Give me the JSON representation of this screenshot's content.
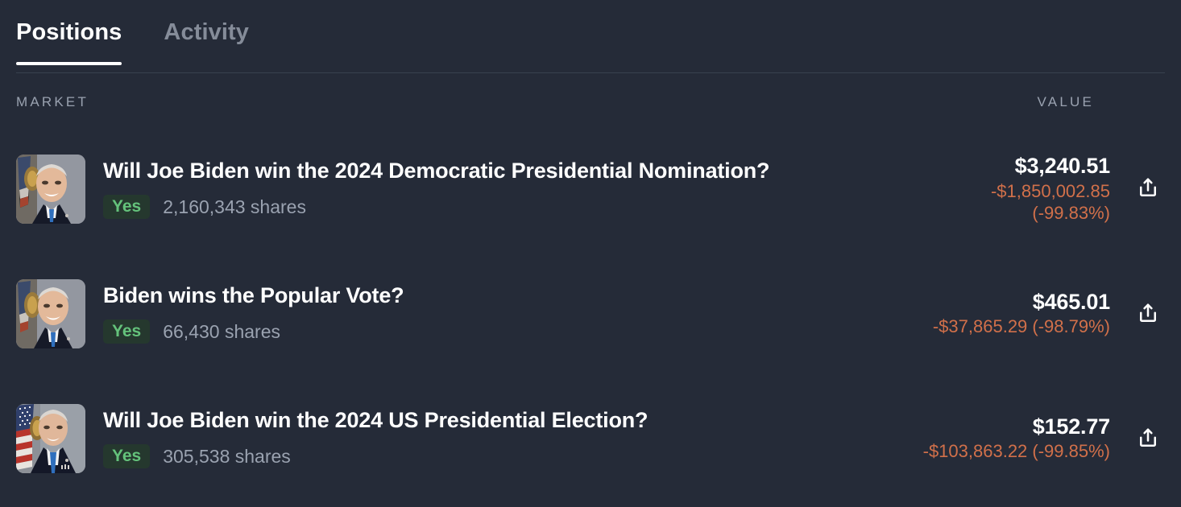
{
  "tabs": [
    {
      "label": "Positions",
      "active": true
    },
    {
      "label": "Activity",
      "active": false
    }
  ],
  "columns": {
    "market": "MARKET",
    "value": "VALUE"
  },
  "colors": {
    "background": "#252b38",
    "text_primary": "#ffffff",
    "text_muted": "#9aa2b0",
    "loss": "#d1704a",
    "yes_text": "#64c27b",
    "yes_background": "#25382e",
    "active_tab_underline": "#ffffff"
  },
  "positions": [
    {
      "avatar": "joe-biden-portrait",
      "title": "Will Joe Biden win the 2024 Democratic Presidential Nomination?",
      "outcome": "Yes",
      "shares": "2,160,343 shares",
      "value": "$3,240.51",
      "change": "-$1,850,002.85 (-99.83%)",
      "change_line1": "-$1,850,002.85",
      "change_line2": "(-99.83%)",
      "change_wraps": true,
      "share_action": "share"
    },
    {
      "avatar": "joe-biden-portrait",
      "title": "Biden wins the Popular Vote?",
      "outcome": "Yes",
      "shares": "66,430 shares",
      "value": "$465.01",
      "change": "-$37,865.29 (-98.79%)",
      "change_line1": "-$37,865.29 (-98.79%)",
      "change_line2": "",
      "change_wraps": false,
      "share_action": "share"
    },
    {
      "avatar": "joe-biden-portrait-flag",
      "title": "Will Joe Biden win the 2024 US Presidential Election?",
      "outcome": "Yes",
      "shares": "305,538 shares",
      "value": "$152.77",
      "change": "-$103,863.22 (-99.85%)",
      "change_line1": "-$103,863.22 (-99.85%)",
      "change_line2": "",
      "change_wraps": false,
      "share_action": "share"
    }
  ]
}
